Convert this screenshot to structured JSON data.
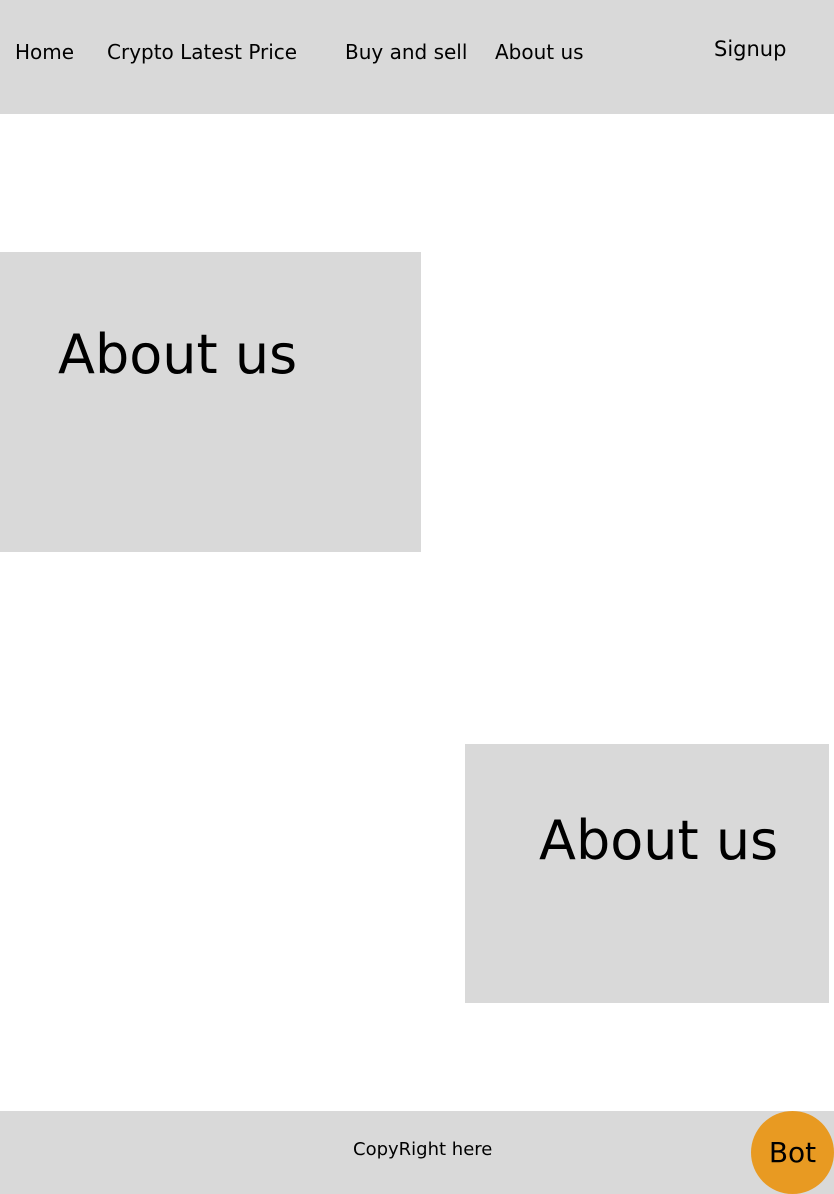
{
  "colors": {
    "panel_background": "#d9d9d9",
    "page_background": "#ffffff",
    "bot_button": "#e89a22",
    "text": "#000000"
  },
  "nav": {
    "home": "Home",
    "crypto_latest_price": "Crypto Latest Price",
    "buy_and_sell": "Buy and sell",
    "about_us": "About us",
    "signup": "Signup"
  },
  "sections": [
    {
      "heading": "About us"
    },
    {
      "heading": "About us"
    }
  ],
  "footer": {
    "copyright": "CopyRight here",
    "bot_label": "Bot"
  }
}
